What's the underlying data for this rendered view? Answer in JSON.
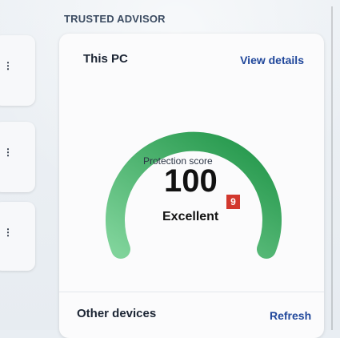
{
  "header": {
    "section_title": "TRUSTED ADVISOR"
  },
  "card": {
    "title": "This PC",
    "link_label": "View details",
    "score_label": "Protection score",
    "score_value": "100",
    "badge_value": "9",
    "score_status": "Excellent",
    "gauge_fraction": 1.0,
    "gauge_color_start": "#7fd39a",
    "gauge_color_end": "#1f9447",
    "badge_color": "#d2382e"
  },
  "footer": {
    "label": "Other devices",
    "refresh_label": "Refresh"
  },
  "icons": {
    "left_menu_icon": "more-vertical-icon"
  }
}
